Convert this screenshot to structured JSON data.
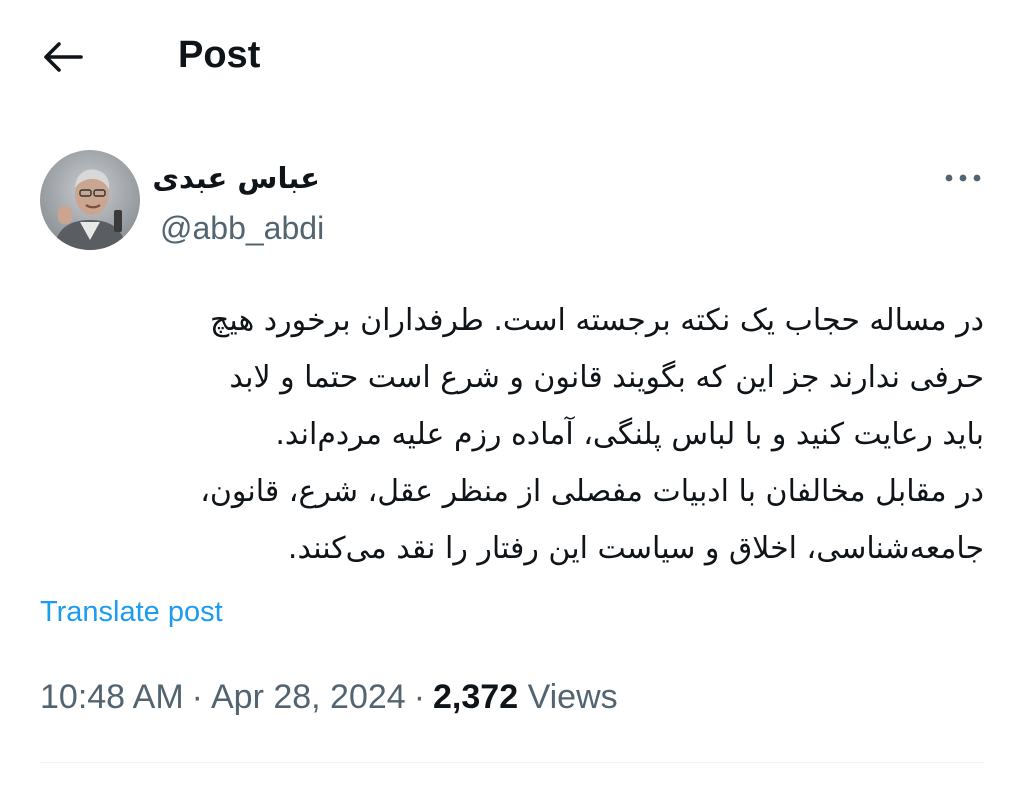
{
  "header": {
    "back_icon": "arrow-left-icon",
    "title": "Post"
  },
  "author": {
    "display_name": "عباس عبدی",
    "handle": "@abb_abdi",
    "avatar_icon": "user-avatar",
    "more_icon": "more-horizontal-icon"
  },
  "post": {
    "lines": [
      "در مساله حجاب یک نکته برجسته است. طرفداران برخورد هیچ",
      "حرفی ندارند جز این که بگویند قانون و شرع است حتما و لابد",
      "باید رعایت کنید و با لباس پلنگی، آماده رزم علیه مردم‌اند.",
      "در مقابل مخالفان با ادبیات مفصلی از منظر عقل، شرع، قانون،",
      "جامعه‌شناسی، اخلاق و سیاست این رفتار را نقد می‌کنند."
    ],
    "translate_label": "Translate post"
  },
  "meta": {
    "time": "10:48 AM",
    "separator": "·",
    "date": "Apr 28, 2024",
    "views_count": "2,372",
    "views_label": "Views"
  },
  "colors": {
    "text": "#0f1419",
    "secondary": "#536471",
    "link": "#1d9bf0",
    "divider": "#eff3f4"
  }
}
